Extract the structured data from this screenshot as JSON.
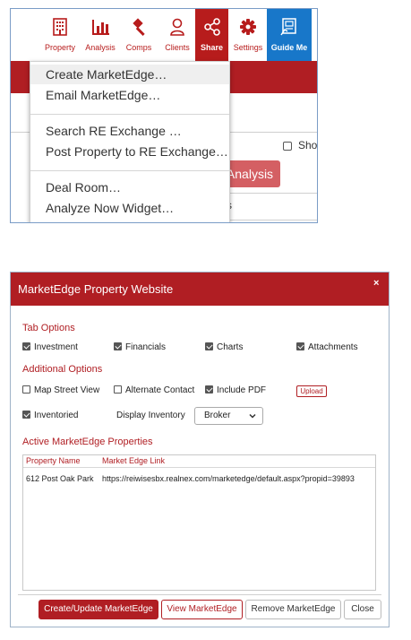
{
  "toolbar": {
    "items": [
      {
        "label": "Property",
        "icon": "building-icon"
      },
      {
        "label": "Analysis",
        "icon": "bar-chart-icon"
      },
      {
        "label": "Comps",
        "icon": "gavel-icon"
      },
      {
        "label": "Clients",
        "icon": "person-icon"
      },
      {
        "label": "Share",
        "icon": "share-icon"
      },
      {
        "label": "Settings",
        "icon": "gear-icon"
      },
      {
        "label": "Guide Me",
        "icon": "guide-icon"
      }
    ]
  },
  "share_menu": {
    "items": [
      "Create MarketEdge…",
      "Email MarketEdge…",
      "Search RE Exchange …",
      "Post Property to RE Exchange…",
      "Deal Room…",
      "Analyze Now Widget…"
    ]
  },
  "background": {
    "show_label": "Sho",
    "analysis_button": "Analysis",
    "partial_text": "s"
  },
  "modal": {
    "title": "MarketEdge Property Website",
    "close_glyph": "×",
    "tab_options": {
      "heading": "Tab Options",
      "investment": "Investment",
      "financials": "Financials",
      "charts": "Charts",
      "attachments": "Attachments"
    },
    "additional_options": {
      "heading": "Additional Options",
      "map_street_view": "Map Street View",
      "alternate_contact": "Alternate Contact",
      "include_pdf": "Include PDF",
      "upload": "Upload",
      "inventoried": "Inventoried",
      "display_inventory": "Display Inventory",
      "display_inventory_value": "Broker"
    },
    "active_properties": {
      "heading": "Active MarketEdge Properties",
      "columns": [
        "Property Name",
        "Market Edge Link"
      ],
      "rows": [
        [
          "612 Post Oak Park",
          "https://reiwisesbx.realnex.com/marketedge/default.aspx?propid=39893"
        ]
      ]
    },
    "buttons": {
      "create": "Create/Update MarketEdge",
      "view": "View MarketEdge",
      "remove": "Remove MarketEdge",
      "close": "Close"
    }
  },
  "colors": {
    "brand_red": "#b01e23",
    "share_bg": "#b71c1c",
    "guide_blue": "#1877c9",
    "analysis_btn": "#d45f63"
  }
}
